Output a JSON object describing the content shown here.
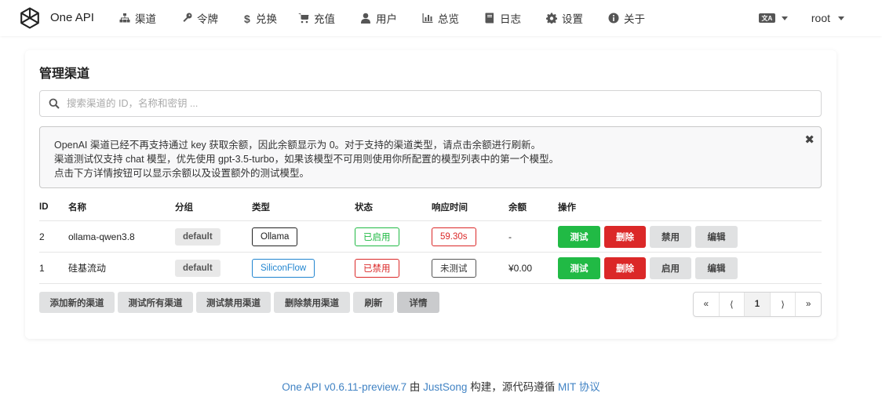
{
  "app": {
    "brand": "One API"
  },
  "nav": {
    "items": [
      {
        "label": "渠道",
        "icon": "sitemap-icon"
      },
      {
        "label": "令牌",
        "icon": "key-icon"
      },
      {
        "label": "兑换",
        "icon": "dollar-icon"
      },
      {
        "label": "充值",
        "icon": "cart-icon"
      },
      {
        "label": "用户",
        "icon": "user-icon"
      },
      {
        "label": "总览",
        "icon": "bar-chart-icon"
      },
      {
        "label": "日志",
        "icon": "book-icon"
      },
      {
        "label": "设置",
        "icon": "gear-icon"
      },
      {
        "label": "关于",
        "icon": "info-icon"
      }
    ],
    "lang_icon": "文A",
    "user": "root"
  },
  "page": {
    "title": "管理渠道",
    "search_placeholder": "搜索渠道的 ID，名称和密钥 ...",
    "notice": [
      "OpenAI 渠道已经不再支持通过 key 获取余额，因此余额显示为 0。对于支持的渠道类型，请点击余额进行刷新。",
      "渠道测试仅支持 chat 模型，优先使用 gpt-3.5-turbo，如果该模型不可用则使用你所配置的模型列表中的第一个模型。",
      "点击下方详情按钮可以显示余额以及设置额外的测试模型。"
    ],
    "notice_close": "✖"
  },
  "table": {
    "headers": [
      "ID",
      "名称",
      "分组",
      "类型",
      "状态",
      "响应时间",
      "余额",
      "操作"
    ],
    "rows": [
      {
        "id": "2",
        "name": "ollama-qwen3.8",
        "group": "default",
        "type": "Ollama",
        "status": "已启用",
        "response": "59.30s",
        "balance": "-",
        "actions": [
          "测试",
          "删除",
          "禁用",
          "编辑"
        ]
      },
      {
        "id": "1",
        "name": "硅基流动",
        "group": "default",
        "type": "SiliconFlow",
        "status": "已禁用",
        "response": "未测试",
        "balance": "¥0.00",
        "actions": [
          "测试",
          "删除",
          "启用",
          "编辑"
        ]
      }
    ]
  },
  "footer_buttons": [
    "添加新的渠道",
    "测试所有渠道",
    "测试禁用渠道",
    "删除禁用渠道",
    "刷新",
    "详情"
  ],
  "pagination": [
    "«",
    "⟨",
    "1",
    "⟩",
    "»"
  ],
  "page_footer": {
    "app": "One API v0.6.11-preview.7",
    "by": " 由 ",
    "author": "JustSong",
    "built": " 构建，源代码遵循 ",
    "license": "MIT 协议"
  },
  "colors": {
    "green": "#21ba45",
    "red": "#db2828",
    "link": "#4183c4",
    "type_blue": "#2185d0"
  }
}
